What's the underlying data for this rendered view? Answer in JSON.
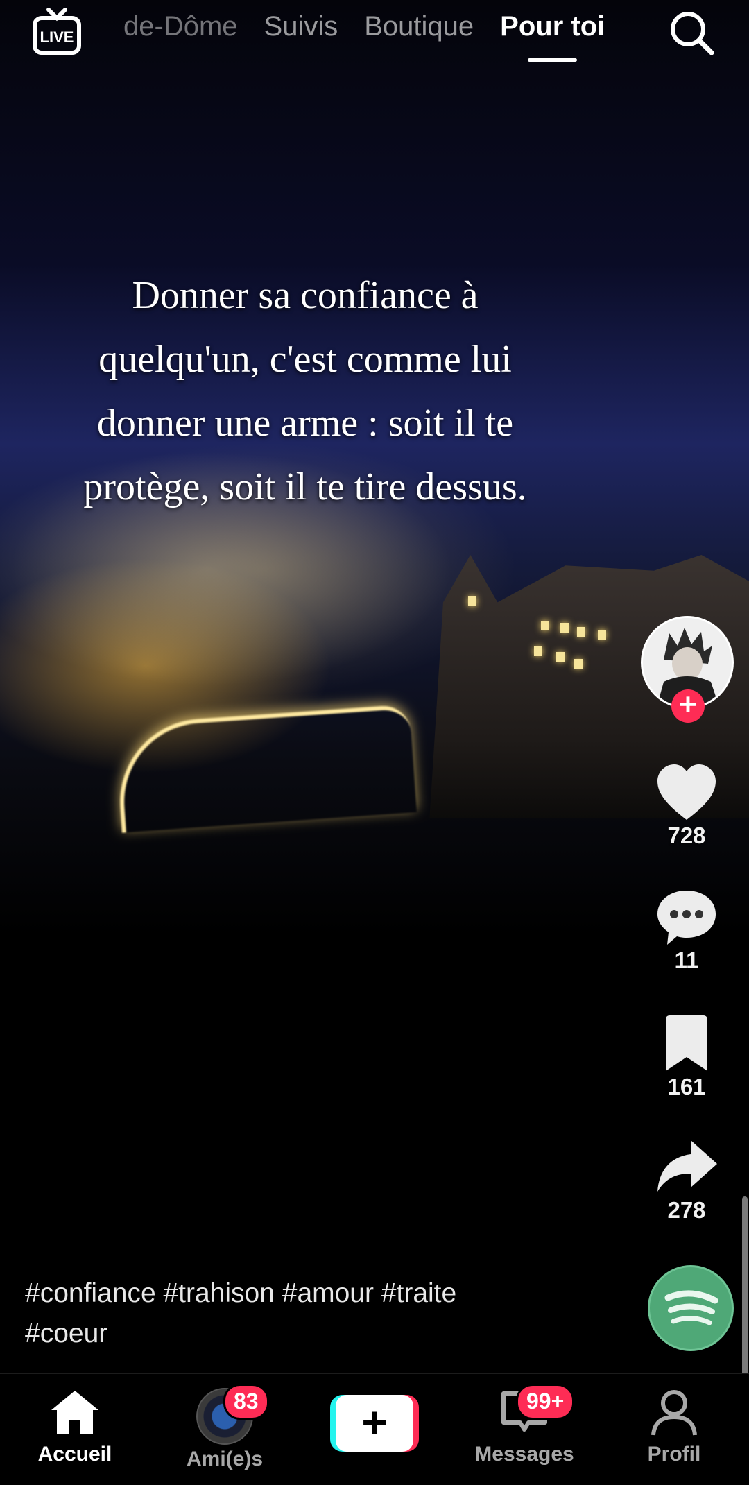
{
  "topnav": {
    "live_label": "LIVE",
    "tabs": [
      {
        "label": "de-Dôme",
        "active": false
      },
      {
        "label": "Suivis",
        "active": false
      },
      {
        "label": "Boutique",
        "active": false
      },
      {
        "label": "Pour toi",
        "active": true
      }
    ],
    "search_icon": "search-icon"
  },
  "video": {
    "overlay_text_lines": [
      "Donner sa confiance à",
      "quelqu'un, c'est comme lui",
      "donner une arme : soit il te",
      "protège, soit il te tire dessus."
    ]
  },
  "actions": {
    "follow_symbol": "+",
    "likes": "728",
    "comments": "11",
    "saves": "161",
    "shares": "278"
  },
  "caption": {
    "line1": "#confiance #trahison #amour #traite",
    "line2": "#coeur"
  },
  "bottombar": {
    "home_label": "Accueil",
    "friends_label": "Ami(e)s",
    "friends_badge": "83",
    "create_symbol": "+",
    "messages_label": "Messages",
    "messages_badge": "99+",
    "profile_label": "Profil"
  },
  "colors": {
    "accent": "#fe2c55",
    "create_cyan": "#25f4ee",
    "music_disc": "#4fa877"
  }
}
